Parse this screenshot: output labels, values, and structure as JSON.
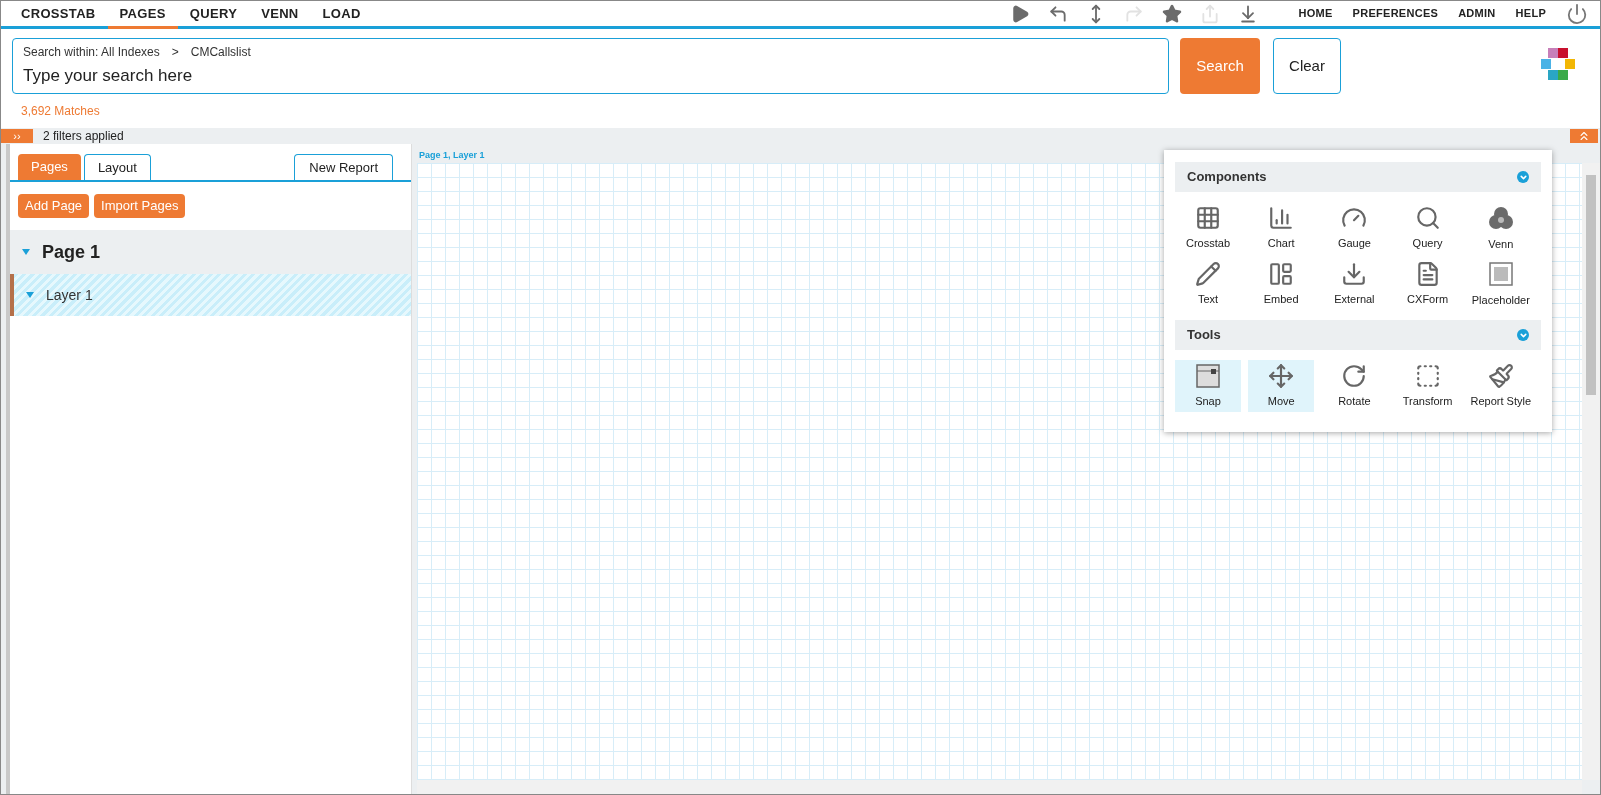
{
  "nav_tabs": [
    {
      "label": "CROSSTAB",
      "selected": false
    },
    {
      "label": "PAGES",
      "selected": true
    },
    {
      "label": "QUERY",
      "selected": false
    },
    {
      "label": "VENN",
      "selected": false
    },
    {
      "label": "LOAD",
      "selected": false
    }
  ],
  "toolbar": [
    {
      "disabled": false
    },
    {
      "disabled": false
    },
    {
      "disabled": false
    },
    {
      "disabled": true
    },
    {
      "disabled": false
    },
    {
      "disabled": true
    },
    {
      "disabled": false
    }
  ],
  "top_links": [
    "HOME",
    "PREFERENCES",
    "ADMIN",
    "HELP"
  ],
  "search": {
    "scope_label": "Search within: All Indexes",
    "separator": ">",
    "scope": "CMCallslist",
    "placeholder": "Type your search here",
    "search_button": "Search",
    "clear_button": "Clear"
  },
  "matches": "3,692 Matches",
  "filter_bar": {
    "toggle": "››",
    "text": "2 filters applied"
  },
  "panel_tabs": [
    {
      "label": "Pages",
      "selected": true
    },
    {
      "label": "Layout",
      "selected": false
    }
  ],
  "new_report": "New Report",
  "panel_buttons": [
    "Add Page",
    "Import Pages"
  ],
  "tree": [
    {
      "label": "Page 1",
      "expanded": true,
      "children": [
        {
          "label": "Layer 1",
          "expanded": true,
          "selected": true
        }
      ]
    }
  ],
  "canvas": {
    "breadcrumb": "Page 1, Layer 1"
  },
  "palette": {
    "sections": [
      {
        "title": "Components",
        "items": [
          {
            "label": "Crosstab",
            "active": false
          },
          {
            "label": "Chart",
            "active": false
          },
          {
            "label": "Gauge",
            "active": false
          },
          {
            "label": "Query",
            "active": false
          },
          {
            "label": "Venn",
            "active": false
          },
          {
            "label": "Text",
            "active": false
          },
          {
            "label": "Embed",
            "active": false
          },
          {
            "label": "External",
            "active": false
          },
          {
            "label": "CXForm",
            "active": false
          },
          {
            "label": "Placeholder",
            "active": false
          }
        ]
      },
      {
        "title": "Tools",
        "items": [
          {
            "label": "Snap",
            "active": true
          },
          {
            "label": "Move",
            "active": true
          },
          {
            "label": "Rotate",
            "active": false
          },
          {
            "label": "Transform",
            "active": false
          },
          {
            "label": "Report Style",
            "active": false
          }
        ]
      }
    ]
  }
}
